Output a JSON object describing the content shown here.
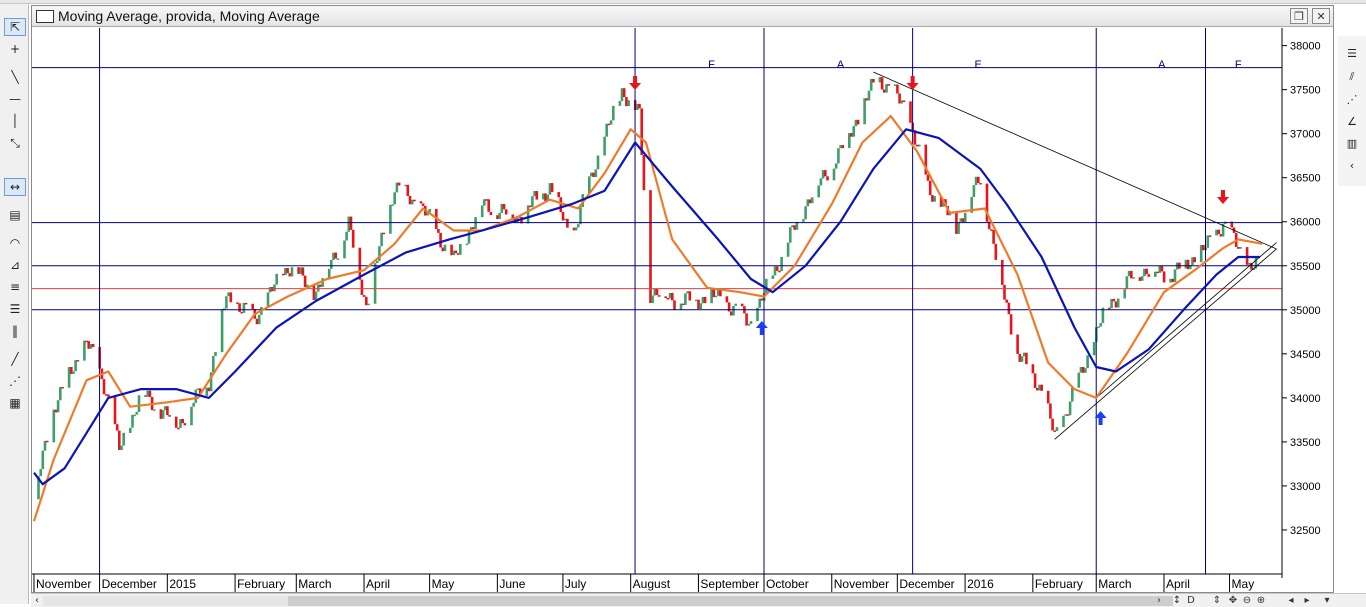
{
  "window": {
    "title": "Moving Average, provida, Moving Average",
    "restore_glyph": "❐",
    "close_glyph": "✕"
  },
  "toolbar": {
    "icons": [
      "cursor-arrow-icon",
      "crosshair-icon",
      "trendline-icon",
      "horizontal-line-icon",
      "vertical-line-icon",
      "spread-tool-icon",
      "zoom-bars-icon",
      "color-swatch-icon",
      "arc-tool-icon",
      "fan-tool-icon",
      "fibonacci-projection-icon",
      "fibonacci-retracement-icon",
      "cycle-lines-icon",
      "diagonal-line-icon",
      "gann-fan-icon",
      "grid-pattern-icon"
    ]
  },
  "right_toolbar": {
    "icons": [
      "list-icon",
      "channel-icon",
      "fan-lines-icon",
      "angle-icon",
      "bars-icon",
      "table-icon",
      "curve-icon"
    ]
  },
  "scrollbar": {
    "left_arrow": "‹",
    "right_arrow": "›",
    "controls": [
      "↕",
      "D",
      "⇕",
      "✥",
      "⊖",
      "⊕",
      "◂",
      "▸",
      "▾"
    ]
  },
  "colors": {
    "grid_blue": "#00007f",
    "ma_fast": "#ef7b2a",
    "ma_slow": "#0b14b8",
    "up_bar": "#3f9e6a",
    "down_bar": "#e8141a",
    "support_red": "#e04040",
    "arrow_up": "#1a3cff",
    "arrow_down": "#e8141a",
    "trendline": "#000000"
  },
  "chart_data": {
    "type": "line",
    "title": "",
    "ylim": [
      32000,
      38200
    ],
    "y_ticks": [
      32500,
      33000,
      33500,
      34000,
      34500,
      35000,
      35500,
      36000,
      36500,
      37000,
      37500,
      38000
    ],
    "xlim": [
      "2014-11-01",
      "2016-05-25"
    ],
    "x_tick_labels": [
      {
        "date": "2014-11-01",
        "label": "November"
      },
      {
        "date": "2014-12-01",
        "label": "December"
      },
      {
        "date": "2015-01-01",
        "label": "2015"
      },
      {
        "date": "2015-02-01",
        "label": "February"
      },
      {
        "date": "2015-03-01",
        "label": "March"
      },
      {
        "date": "2015-04-01",
        "label": "April"
      },
      {
        "date": "2015-05-01",
        "label": "May"
      },
      {
        "date": "2015-06-01",
        "label": "June"
      },
      {
        "date": "2015-07-01",
        "label": "July"
      },
      {
        "date": "2015-08-01",
        "label": "August"
      },
      {
        "date": "2015-09-01",
        "label": "September"
      },
      {
        "date": "2015-10-01",
        "label": "October"
      },
      {
        "date": "2015-11-01",
        "label": "November"
      },
      {
        "date": "2015-12-01",
        "label": "December"
      },
      {
        "date": "2016-01-01",
        "label": "2016"
      },
      {
        "date": "2016-02-01",
        "label": "February"
      },
      {
        "date": "2016-03-01",
        "label": "March"
      },
      {
        "date": "2016-04-01",
        "label": "April"
      },
      {
        "date": "2016-05-01",
        "label": "May"
      }
    ],
    "horizontal_levels": [
      {
        "value": 37750,
        "color": "#00007f"
      },
      {
        "value": 35990,
        "color": "#00007f"
      },
      {
        "value": 35500,
        "color": "#00007f"
      },
      {
        "value": 35000,
        "color": "#00007f"
      },
      {
        "value": 35240,
        "color": "#e04040"
      }
    ],
    "vertical_markers": [
      {
        "date": "2014-12-01"
      },
      {
        "date": "2015-08-03"
      },
      {
        "date": "2015-10-01"
      },
      {
        "date": "2015-12-08"
      },
      {
        "date": "2016-03-01"
      },
      {
        "date": "2016-04-20"
      }
    ],
    "section_labels": [
      {
        "date": "2015-09-07",
        "label": "F"
      },
      {
        "date": "2015-11-05",
        "label": "A"
      },
      {
        "date": "2016-01-07",
        "label": "E"
      },
      {
        "date": "2016-03-31",
        "label": "A"
      },
      {
        "date": "2016-05-05",
        "label": "F"
      }
    ],
    "signals": [
      {
        "date": "2015-08-03",
        "direction": "down"
      },
      {
        "date": "2015-09-30",
        "direction": "up"
      },
      {
        "date": "2015-12-08",
        "direction": "down"
      },
      {
        "date": "2016-03-03",
        "direction": "up"
      },
      {
        "date": "2016-04-28",
        "direction": "down"
      }
    ],
    "trendlines": [
      {
        "from": {
          "date": "2015-11-20",
          "value": 37700
        },
        "to": {
          "date": "2016-05-17",
          "value": 35850
        }
      },
      {
        "from": {
          "date": "2016-02-11",
          "value": 33530
        },
        "to": {
          "date": "2016-05-17",
          "value": 35850
        }
      },
      {
        "from": {
          "date": "2016-03-01",
          "value": 34000
        },
        "to": {
          "date": "2016-05-17",
          "value": 35650
        }
      }
    ],
    "price_anchors": [
      {
        "date": "2014-11-01",
        "value": 32850
      },
      {
        "date": "2014-11-10",
        "value": 33900
      },
      {
        "date": "2014-11-25",
        "value": 34650
      },
      {
        "date": "2014-12-04",
        "value": 34100
      },
      {
        "date": "2014-12-10",
        "value": 33400
      },
      {
        "date": "2014-12-20",
        "value": 34050
      },
      {
        "date": "2015-01-06",
        "value": 33700
      },
      {
        "date": "2015-01-20",
        "value": 34200
      },
      {
        "date": "2015-01-28",
        "value": 35150
      },
      {
        "date": "2015-02-10",
        "value": 34900
      },
      {
        "date": "2015-02-25",
        "value": 35500
      },
      {
        "date": "2015-03-10",
        "value": 35200
      },
      {
        "date": "2015-03-25",
        "value": 35950
      },
      {
        "date": "2015-04-02",
        "value": 35050
      },
      {
        "date": "2015-04-15",
        "value": 36400
      },
      {
        "date": "2015-04-28",
        "value": 36150
      },
      {
        "date": "2015-05-12",
        "value": 35550
      },
      {
        "date": "2015-05-25",
        "value": 36200
      },
      {
        "date": "2015-06-10",
        "value": 36050
      },
      {
        "date": "2015-06-25",
        "value": 36400
      },
      {
        "date": "2015-07-05",
        "value": 35800
      },
      {
        "date": "2015-07-15",
        "value": 36600
      },
      {
        "date": "2015-07-28",
        "value": 37500
      },
      {
        "date": "2015-08-05",
        "value": 37200
      },
      {
        "date": "2015-08-10",
        "value": 35200
      },
      {
        "date": "2015-08-25",
        "value": 35100
      },
      {
        "date": "2015-09-10",
        "value": 35150
      },
      {
        "date": "2015-09-25",
        "value": 34850
      },
      {
        "date": "2015-10-05",
        "value": 35400
      },
      {
        "date": "2015-10-20",
        "value": 36200
      },
      {
        "date": "2015-11-05",
        "value": 36800
      },
      {
        "date": "2015-11-22",
        "value": 37650
      },
      {
        "date": "2015-12-05",
        "value": 37300
      },
      {
        "date": "2015-12-15",
        "value": 36400
      },
      {
        "date": "2015-12-28",
        "value": 35950
      },
      {
        "date": "2016-01-08",
        "value": 36500
      },
      {
        "date": "2016-01-15",
        "value": 35600
      },
      {
        "date": "2016-01-25",
        "value": 34500
      },
      {
        "date": "2016-02-05",
        "value": 34100
      },
      {
        "date": "2016-02-11",
        "value": 33550
      },
      {
        "date": "2016-02-22",
        "value": 34200
      },
      {
        "date": "2016-03-05",
        "value": 35000
      },
      {
        "date": "2016-03-20",
        "value": 35450
      },
      {
        "date": "2016-04-05",
        "value": 35400
      },
      {
        "date": "2016-04-20",
        "value": 35700
      },
      {
        "date": "2016-04-28",
        "value": 35990
      },
      {
        "date": "2016-05-10",
        "value": 35500
      },
      {
        "date": "2016-05-13",
        "value": 35500
      }
    ],
    "series": [
      {
        "points": [
          [
            "2014-11-01",
            32600
          ],
          [
            "2014-11-10",
            33300
          ],
          [
            "2014-11-25",
            34200
          ],
          [
            "2014-12-05",
            34300
          ],
          [
            "2014-12-15",
            33900
          ],
          [
            "2015-01-01",
            33950
          ],
          [
            "2015-01-15",
            34000
          ],
          [
            "2015-01-28",
            34500
          ],
          [
            "2015-02-10",
            34950
          ],
          [
            "2015-02-25",
            35150
          ],
          [
            "2015-03-15",
            35350
          ],
          [
            "2015-04-01",
            35450
          ],
          [
            "2015-04-15",
            35750
          ],
          [
            "2015-04-28",
            36150
          ],
          [
            "2015-05-12",
            35900
          ],
          [
            "2015-05-25",
            35900
          ],
          [
            "2015-06-10",
            36050
          ],
          [
            "2015-06-25",
            36250
          ],
          [
            "2015-07-08",
            36150
          ],
          [
            "2015-07-20",
            36550
          ],
          [
            "2015-08-01",
            37050
          ],
          [
            "2015-08-08",
            36900
          ],
          [
            "2015-08-20",
            35800
          ],
          [
            "2015-09-05",
            35250
          ],
          [
            "2015-09-20",
            35200
          ],
          [
            "2015-10-01",
            35150
          ],
          [
            "2015-10-15",
            35500
          ],
          [
            "2015-11-01",
            36200
          ],
          [
            "2015-11-15",
            36900
          ],
          [
            "2015-11-28",
            37200
          ],
          [
            "2015-12-10",
            36800
          ],
          [
            "2015-12-25",
            36100
          ],
          [
            "2016-01-10",
            36150
          ],
          [
            "2016-01-25",
            35400
          ],
          [
            "2016-02-08",
            34400
          ],
          [
            "2016-02-20",
            34100
          ],
          [
            "2016-03-01",
            34000
          ],
          [
            "2016-03-15",
            34500
          ],
          [
            "2016-04-01",
            35200
          ],
          [
            "2016-04-15",
            35450
          ],
          [
            "2016-04-28",
            35700
          ],
          [
            "2016-05-05",
            35800
          ],
          [
            "2016-05-16",
            35750
          ]
        ]
      },
      {
        "points": [
          [
            "2014-11-01",
            33150
          ],
          [
            "2014-11-05",
            33020
          ],
          [
            "2014-11-15",
            33200
          ],
          [
            "2014-11-25",
            33600
          ],
          [
            "2014-12-05",
            34000
          ],
          [
            "2014-12-20",
            34100
          ],
          [
            "2015-01-05",
            34100
          ],
          [
            "2015-01-20",
            34000
          ],
          [
            "2015-02-01",
            34300
          ],
          [
            "2015-02-20",
            34800
          ],
          [
            "2015-03-10",
            35100
          ],
          [
            "2015-04-01",
            35400
          ],
          [
            "2015-04-20",
            35650
          ],
          [
            "2015-05-10",
            35800
          ],
          [
            "2015-05-25",
            35900
          ],
          [
            "2015-06-15",
            36050
          ],
          [
            "2015-07-05",
            36200
          ],
          [
            "2015-07-20",
            36350
          ],
          [
            "2015-08-03",
            36900
          ],
          [
            "2015-08-20",
            36400
          ],
          [
            "2015-09-10",
            35800
          ],
          [
            "2015-09-25",
            35350
          ],
          [
            "2015-10-05",
            35200
          ],
          [
            "2015-10-20",
            35500
          ],
          [
            "2015-11-05",
            36000
          ],
          [
            "2015-11-20",
            36600
          ],
          [
            "2015-12-05",
            37050
          ],
          [
            "2015-12-20",
            36950
          ],
          [
            "2016-01-08",
            36600
          ],
          [
            "2016-01-20",
            36200
          ],
          [
            "2016-02-05",
            35600
          ],
          [
            "2016-02-20",
            34800
          ],
          [
            "2016-03-01",
            34350
          ],
          [
            "2016-03-10",
            34300
          ],
          [
            "2016-03-25",
            34550
          ],
          [
            "2016-04-10",
            35000
          ],
          [
            "2016-04-25",
            35400
          ],
          [
            "2016-05-05",
            35600
          ],
          [
            "2016-05-15",
            35600
          ]
        ]
      }
    ],
    "y_axis_side": "right",
    "grid": false
  }
}
